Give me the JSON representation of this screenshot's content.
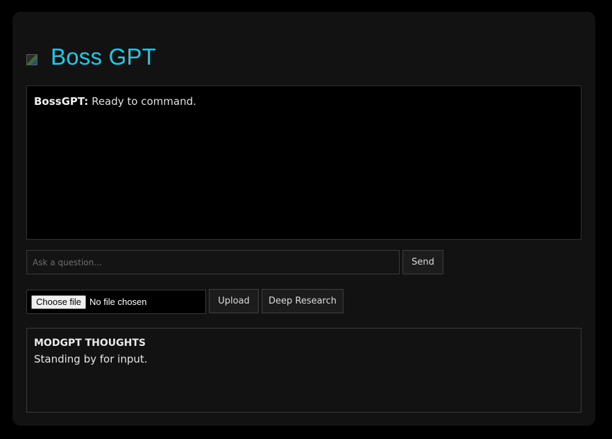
{
  "app": {
    "title": "Boss GPT",
    "accent_color": "#1ec8e6",
    "logo_icon": "broken-image-icon"
  },
  "chat": {
    "messages": [
      {
        "sender": "BossGPT:",
        "text": " Ready to command."
      }
    ]
  },
  "ask": {
    "placeholder": "Ask a question...",
    "value": "",
    "send_label": "Send"
  },
  "file": {
    "choose_label": "Choose file",
    "status": "No file chosen",
    "upload_label": "Upload",
    "deep_research_label": "Deep Research"
  },
  "thoughts": {
    "heading": "MODGPT THOUGHTS",
    "text": "Standing by for input."
  }
}
